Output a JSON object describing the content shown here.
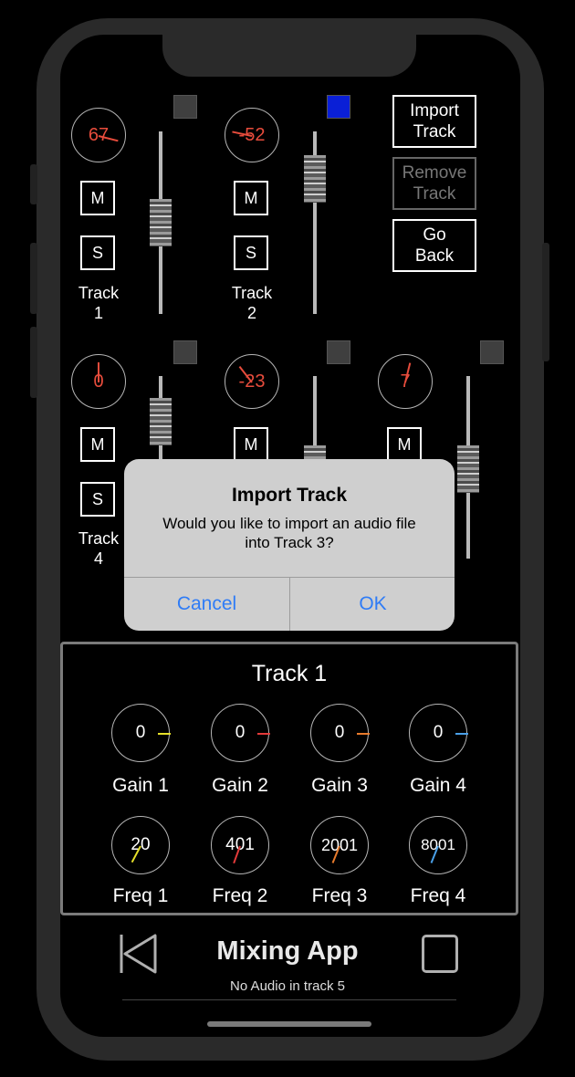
{
  "app": {
    "title": "Mixing App",
    "status": "No Audio in track 5"
  },
  "tracks": [
    {
      "label_line1": "Track",
      "label_line2": "1",
      "pan": "67",
      "mute": "M",
      "solo": "S",
      "color": "#3f3f3f"
    },
    {
      "label_line1": "Track",
      "label_line2": "2",
      "pan": "-52",
      "mute": "M",
      "solo": "S",
      "color": "#0a1fd6"
    },
    {
      "label_line1": "Track",
      "label_line2": "4",
      "pan": "0",
      "mute": "M",
      "solo": "S",
      "color": "#3f3f3f"
    },
    {
      "pan": "-23",
      "mute": "M",
      "color": "#3f3f3f"
    },
    {
      "pan": "7",
      "mute": "M",
      "color": "#3f3f3f"
    }
  ],
  "controls": {
    "import": {
      "line1": "Import",
      "line2": "Track"
    },
    "remove": {
      "line1": "Remove",
      "line2": "Track"
    },
    "back": {
      "line1": "Go",
      "line2": "Back"
    }
  },
  "dialog": {
    "title": "Import Track",
    "message_line1": "Would you like to import an audio file",
    "message_line2": "into Track 3?",
    "cancel": "Cancel",
    "ok": "OK"
  },
  "eq_panel": {
    "title": "Track 1",
    "gains": [
      {
        "value": "0",
        "label": "Gain 1",
        "color": "#e6e02a"
      },
      {
        "value": "0",
        "label": "Gain 2",
        "color": "#e23a3a"
      },
      {
        "value": "0",
        "label": "Gain 3",
        "color": "#e87b2c"
      },
      {
        "value": "0",
        "label": "Gain 4",
        "color": "#4aa0e8"
      }
    ],
    "freqs": [
      {
        "value": "20",
        "label": "Freq 1",
        "color": "#e6e02a"
      },
      {
        "value": "401",
        "label": "Freq 2",
        "color": "#e23a3a"
      },
      {
        "value": "2001",
        "label": "Freq 3",
        "color": "#e87b2c"
      },
      {
        "value": "8001",
        "label": "Freq 4",
        "color": "#4aa0e8"
      }
    ]
  },
  "icons": {
    "back": "skip-back-icon",
    "stop": "stop-icon"
  }
}
